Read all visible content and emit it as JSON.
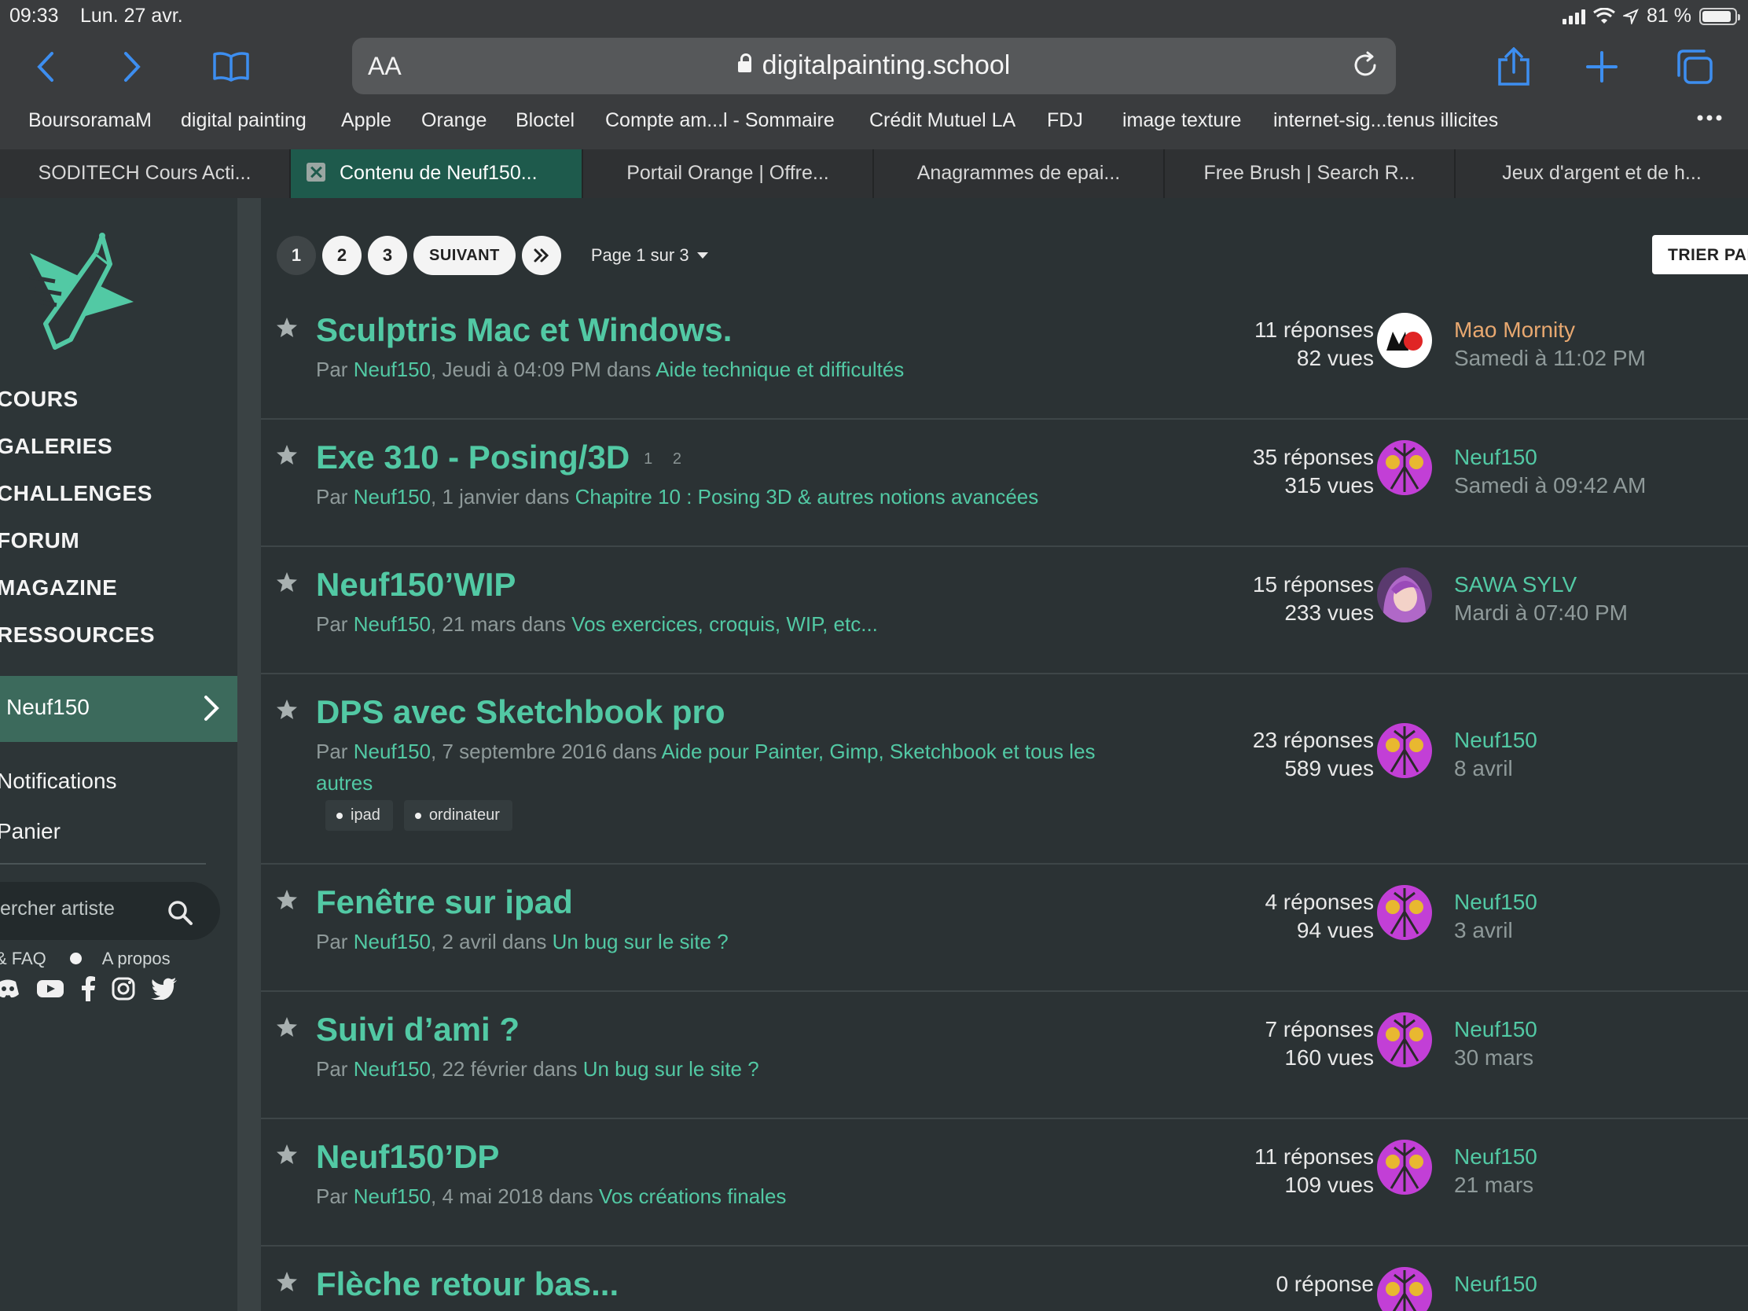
{
  "status": {
    "time": "09:33",
    "date": "Lun. 27 avr.",
    "battery": "81 %"
  },
  "browser": {
    "aa_label": "AA",
    "url": "digitalpainting.school",
    "bookmarks": [
      "BoursoramaM",
      "digital painting",
      "Apple",
      "Orange",
      "Bloctel",
      "Compte am...l - Sommaire",
      "Crédit Mutuel LA",
      "FDJ",
      "image texture",
      "internet-sig...tenus illicites"
    ],
    "tabs": [
      "SODITECH Cours Acti...",
      "Contenu de Neuf150...",
      "Portail Orange | Offre...",
      "Anagrammes de epai...",
      "Free Brush | Search R...",
      "Jeux d'argent et de h..."
    ]
  },
  "sidebar": {
    "menu": [
      "COURS",
      "GALERIES",
      "CHALLENGES",
      "FORUM",
      "MAGAZINE",
      "RESSOURCES"
    ],
    "user": "Neuf150",
    "notifications": "Notifications",
    "cart": "Panier",
    "search_placeholder": "ercher artiste",
    "footer_faq": "& FAQ",
    "footer_about": "A propos"
  },
  "pager": {
    "pages": [
      "1",
      "2",
      "3"
    ],
    "next": "SUIVANT",
    "page_label": "Page 1 sur 3",
    "sort": "TRIER PAR"
  },
  "topics": [
    {
      "title": "Sculptris Mac et Windows.",
      "pages": "",
      "by": "Par",
      "author": "Neuf150",
      "date": ", Jeudi à 04:09 PM dans",
      "forum": "Aide technique et difficultés",
      "tags": [],
      "replies": "11 réponses",
      "views": "82 vues",
      "last_user": "Mao Mornity",
      "last_date": "Samedi à 11:02 PM"
    },
    {
      "title": "Exe 310 - Posing/3D",
      "pages": "1 2",
      "by": "Par",
      "author": "Neuf150",
      "date": ", 1 janvier dans",
      "forum": "Chapitre 10 : Posing 3D & autres notions avancées",
      "tags": [],
      "replies": "35 réponses",
      "views": "315 vues",
      "last_user": "Neuf150",
      "last_date": "Samedi à 09:42 AM"
    },
    {
      "title": "Neuf150’WIP",
      "pages": "",
      "by": "Par",
      "author": "Neuf150",
      "date": ", 21 mars dans",
      "forum": "Vos exercices, croquis, WIP, etc...",
      "tags": [],
      "replies": "15 réponses",
      "views": "233 vues",
      "last_user": "SAWA SYLV",
      "last_date": "Mardi à 07:40 PM"
    },
    {
      "title": "DPS avec Sketchbook pro",
      "pages": "",
      "by": "Par",
      "author": "Neuf150",
      "date": ", 7 septembre 2016 dans",
      "forum": "Aide pour Painter, Gimp, Sketchbook et tous les autres",
      "tags": [
        "ipad",
        "ordinateur"
      ],
      "replies": "23 réponses",
      "views": "589 vues",
      "last_user": "Neuf150",
      "last_date": "8 avril"
    },
    {
      "title": "Fenêtre sur ipad",
      "pages": "",
      "by": "Par",
      "author": "Neuf150",
      "date": ", 2 avril dans",
      "forum": "Un bug sur le site ?",
      "tags": [],
      "replies": "4 réponses",
      "views": "94 vues",
      "last_user": "Neuf150",
      "last_date": "3 avril"
    },
    {
      "title": "Suivi d’ami ?",
      "pages": "",
      "by": "Par",
      "author": "Neuf150",
      "date": ", 22 février dans",
      "forum": "Un bug sur le site ?",
      "tags": [],
      "replies": "7 réponses",
      "views": "160 vues",
      "last_user": "Neuf150",
      "last_date": "30 mars"
    },
    {
      "title": "Neuf150’DP",
      "pages": "",
      "by": "Par",
      "author": "Neuf150",
      "date": ", 4 mai 2018 dans",
      "forum": "Vos créations finales",
      "tags": [],
      "replies": "11 réponses",
      "views": "109 vues",
      "last_user": "Neuf150",
      "last_date": "21 mars"
    },
    {
      "title": "Flèche retour bas...",
      "pages": "",
      "by": "",
      "author": "",
      "date": "",
      "forum": "",
      "tags": [],
      "replies": "0 réponse",
      "views": "",
      "last_user": "Neuf150",
      "last_date": ""
    }
  ],
  "colors": {
    "accent": "#52c9a4",
    "background": "#2b3234",
    "sidebar": "#2d3537",
    "active_tab": "#1e5a4c",
    "user_row": "#3c6a5c",
    "orange_user": "#e8a870"
  }
}
